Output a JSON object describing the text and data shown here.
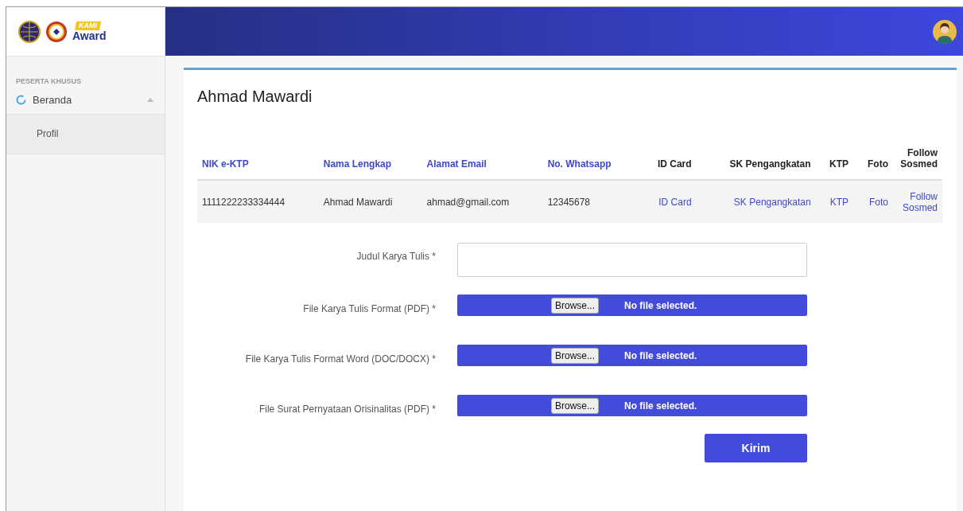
{
  "logo": {
    "badge": "KAMI",
    "word": "Award"
  },
  "sidebar": {
    "section": "PESERTA KHUSUS",
    "items": [
      {
        "label": "Beranda",
        "expanded": true,
        "children": [
          {
            "label": "Profil",
            "selected": true
          }
        ]
      }
    ]
  },
  "page_title": "Ahmad Mawardi",
  "table": {
    "columns": [
      {
        "label": "NIK e-KTP",
        "sortable": true
      },
      {
        "label": "Nama Lengkap",
        "sortable": true
      },
      {
        "label": "Alamat Email",
        "sortable": true
      },
      {
        "label": "No. Whatsapp",
        "sortable": true
      },
      {
        "label": "ID Card",
        "sortable": false
      },
      {
        "label": "SK Pengangkatan",
        "sortable": false
      },
      {
        "label": "KTP",
        "sortable": false
      },
      {
        "label": "Foto",
        "sortable": false
      },
      {
        "label": "Follow Sosmed",
        "sortable": false
      }
    ],
    "rows": [
      [
        {
          "text": "1111222233334444",
          "kind": "text"
        },
        {
          "text": "Ahmad Mawardi",
          "kind": "text"
        },
        {
          "text": "ahmad@gmail.com",
          "kind": "text"
        },
        {
          "text": "12345678",
          "kind": "text"
        },
        {
          "text": "ID Card",
          "kind": "link"
        },
        {
          "text": "SK Pengangkatan",
          "kind": "link"
        },
        {
          "text": "KTP",
          "kind": "link"
        },
        {
          "text": "Foto",
          "kind": "link"
        },
        {
          "text": "Follow Sosmed",
          "kind": "link"
        }
      ]
    ]
  },
  "form": {
    "fields": [
      {
        "label": "Judul Karya Tulis *",
        "kind": "text"
      },
      {
        "label": "File Karya Tulis Format (PDF) *",
        "kind": "file",
        "button": "Browse...",
        "status": "No file selected."
      },
      {
        "label": "File Karya Tulis Format Word (DOC/DOCX) *",
        "kind": "file",
        "button": "Browse...",
        "status": "No file selected."
      },
      {
        "label": "File Surat Pernyataan Orisinalitas (PDF) *",
        "kind": "file",
        "button": "Browse...",
        "status": "No file selected."
      }
    ],
    "submit": "Kirim"
  }
}
